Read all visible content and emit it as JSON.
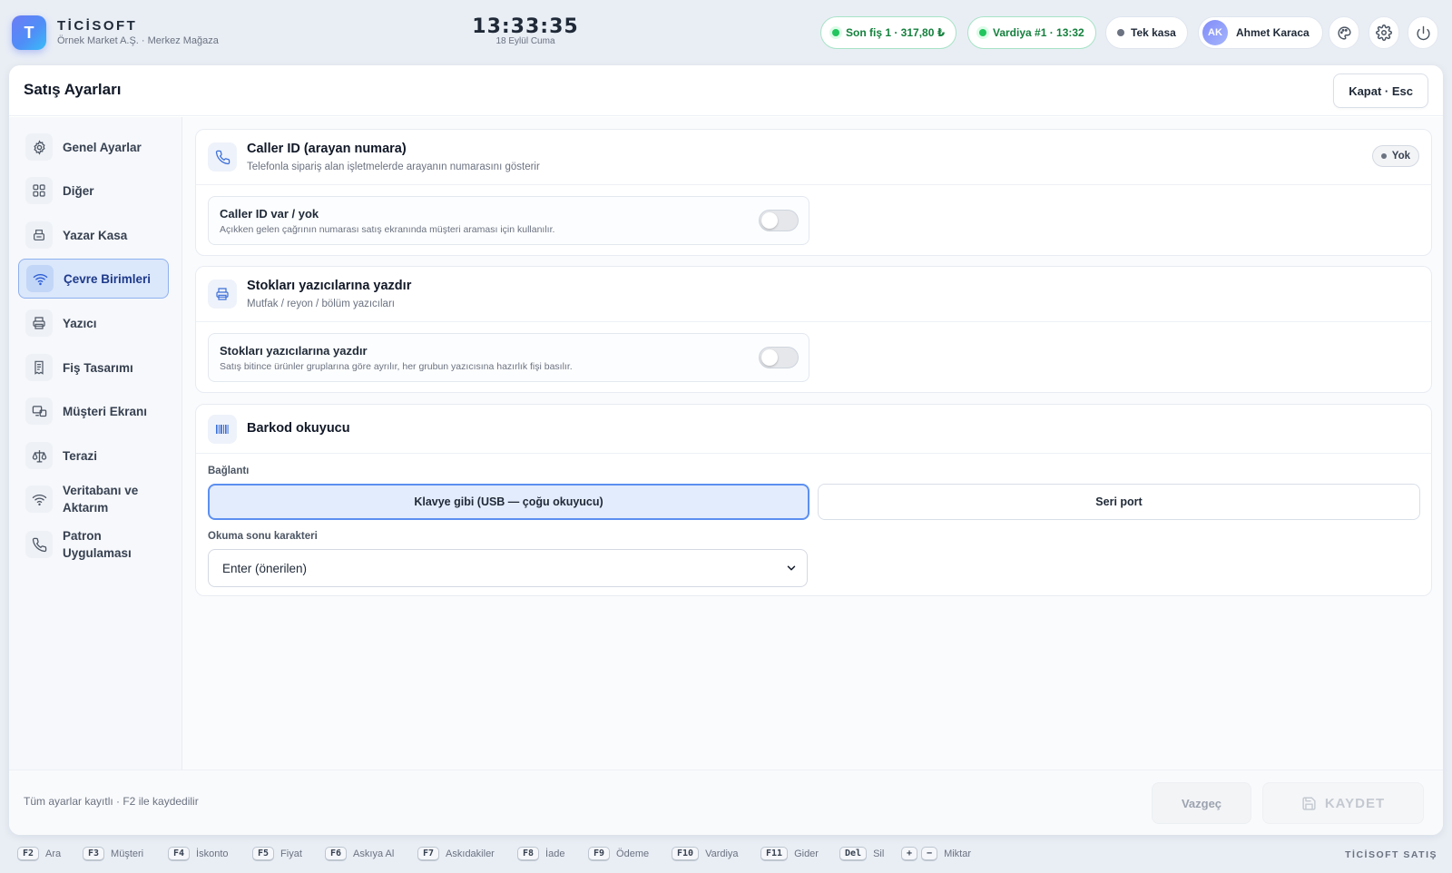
{
  "header": {
    "logo_letter": "T",
    "brand": "TİCİSOFT",
    "company": "Örnek Market A.Ş. · Merkez Mağaza",
    "clock": "13:33:35",
    "date": "18 Eylül Cuma",
    "last_receipt": "Son fiş 1 · 317,80 ₺",
    "shift": "Vardiya #1 · 13:32",
    "register_mode": "Tek kasa",
    "user_initials": "AK",
    "user_name": "Ahmet Karaca"
  },
  "panel": {
    "title": "Satış Ayarları",
    "close_label": "Kapat · Esc"
  },
  "sidebar": {
    "items": [
      {
        "label": "Genel Ayarlar",
        "icon": "gear-icon"
      },
      {
        "label": "Diğer",
        "icon": "grid-icon"
      },
      {
        "label": "Yazar Kasa",
        "icon": "cash-register-icon"
      },
      {
        "label": "Çevre Birimleri",
        "icon": "wifi-icon",
        "active": true
      },
      {
        "label": "Yazıcı",
        "icon": "printer-icon"
      },
      {
        "label": "Fiş Tasarımı",
        "icon": "receipt-icon"
      },
      {
        "label": "Müşteri Ekranı",
        "icon": "monitor-icon"
      },
      {
        "label": "Terazi",
        "icon": "scale-icon"
      },
      {
        "label": "Veritabanı ve Aktarım",
        "icon": "wifi-icon"
      },
      {
        "label": "Patron Uygulaması",
        "icon": "phone-icon"
      }
    ]
  },
  "caller_id": {
    "title": "Caller ID (arayan numara)",
    "subtitle": "Telefonla sipariş alan işletmelerde arayanın numarasını gösterir",
    "badge": "Yok",
    "row_title": "Caller ID var / yok",
    "row_sub": "Açıkken gelen çağrının numarası satış ekranında müşteri araması için kullanılır.",
    "enabled": false
  },
  "stock_print": {
    "title": "Stokları yazıcılarına yazdır",
    "subtitle": "Mutfak / reyon / bölüm yazıcıları",
    "row_title": "Stokları yazıcılarına yazdır",
    "row_sub": "Satış bitince ürünler gruplarına göre ayrılır, her grubun yazıcısına hazırlık fişi basılır.",
    "enabled": false
  },
  "barcode": {
    "title": "Barkod okuyucu",
    "connection_label": "Bağlantı",
    "options": [
      "Klavye gibi (USB — çoğu okuyucu)",
      "Seri port"
    ],
    "selected_option": "Klavye gibi (USB — çoğu okuyucu)",
    "suffix_label": "Okuma sonu karakteri",
    "suffix_value": "Enter (önerilen)"
  },
  "footer": {
    "note": "Tüm ayarlar kayıtlı · F2 ile kaydedilir",
    "cancel_label": "Vazgeç",
    "save_label": "KAYDET"
  },
  "shortcuts": [
    {
      "key": "F2",
      "label": "Ara"
    },
    {
      "key": "F3",
      "label": "Müşteri"
    },
    {
      "key": "F4",
      "label": "İskonto"
    },
    {
      "key": "F5",
      "label": "Fiyat"
    },
    {
      "key": "F6",
      "label": "Askıya Al"
    },
    {
      "key": "F7",
      "label": "Askıdakiler"
    },
    {
      "key": "F8",
      "label": "İade"
    },
    {
      "key": "F9",
      "label": "Ödeme"
    },
    {
      "key": "F10",
      "label": "Vardiya"
    },
    {
      "key": "F11",
      "label": "Gider"
    },
    {
      "key": "Del",
      "label": "Sil"
    },
    {
      "key": "+",
      "key2": "−",
      "label": "Miktar"
    }
  ],
  "shortcut_brand": "TİCİSOFT SATIŞ",
  "colors": {
    "accent": "#5c8ff0",
    "success": "#22c55e",
    "active_nav_bg": "#dbe7fb"
  }
}
